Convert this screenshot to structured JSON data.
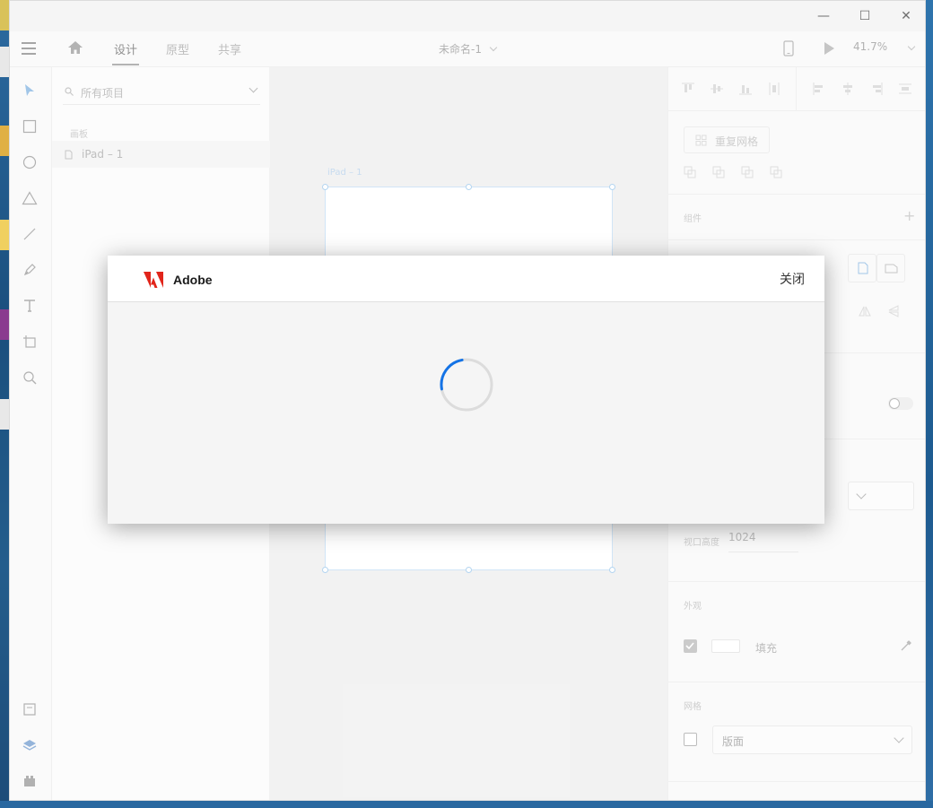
{
  "window": {
    "minimize_glyph": "—",
    "maximize_glyph": "☐",
    "close_glyph": "✕"
  },
  "appbar": {
    "tabs": [
      {
        "label": "设计",
        "active": true
      },
      {
        "label": "原型",
        "active": false
      },
      {
        "label": "共享",
        "active": false
      }
    ],
    "document_title": "未命名-1",
    "zoom": "41.7%"
  },
  "toolbar": {
    "tools": [
      "select-icon",
      "rectangle-icon",
      "ellipse-icon",
      "triangle-icon",
      "line-icon",
      "pen-icon",
      "text-icon",
      "artboard-icon",
      "zoom-icon"
    ],
    "bottom_tools": [
      "assets-icon",
      "layers-icon",
      "plugins-icon"
    ]
  },
  "layers": {
    "search_placeholder": "所有项目",
    "section_label": "画板",
    "items": [
      {
        "label": "iPad – 1"
      }
    ]
  },
  "canvas": {
    "artboard_label": "iPad – 1"
  },
  "props": {
    "repeat_grid_label": "重复网格",
    "component_label": "组件",
    "viewport_height_label": "视口高度",
    "viewport_height_value": "1024",
    "appearance_label": "外观",
    "fill_label": "填充",
    "fill_checked": true,
    "grid_label": "网格",
    "grid_checked": false,
    "grid_select_value": "版面"
  },
  "dialog": {
    "brand": "Adobe",
    "close_label": "关闭",
    "brand_color": "#e1251b",
    "spinner_color": "#1473e6"
  }
}
